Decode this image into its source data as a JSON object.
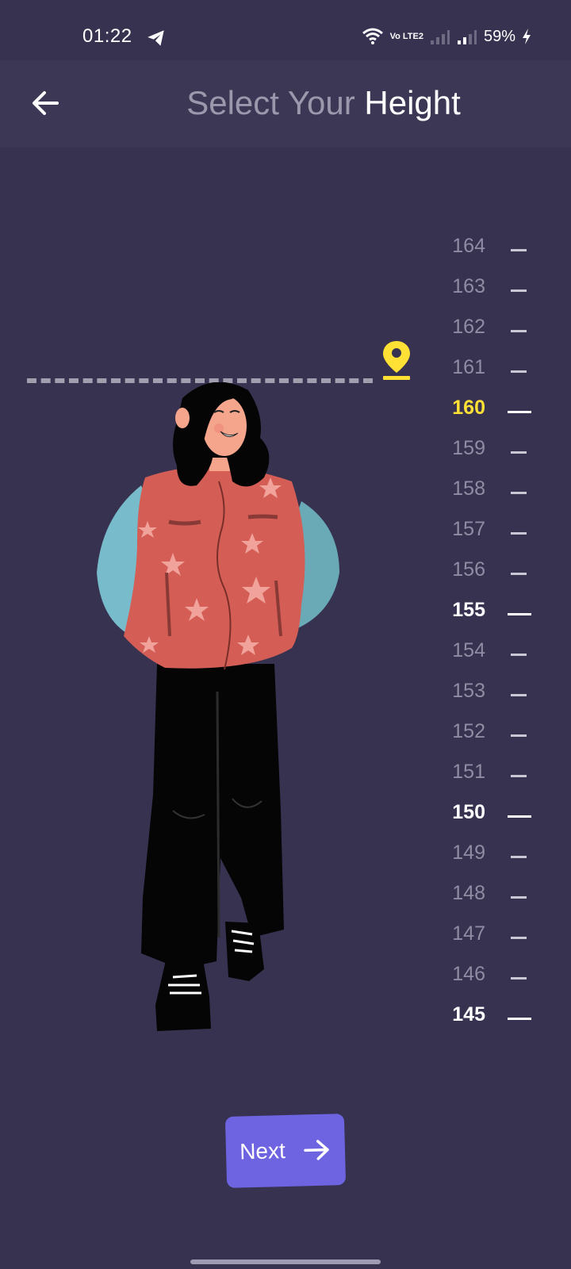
{
  "status_bar": {
    "time": "01:22",
    "battery": "59%",
    "network_tag": "Vo LTE2"
  },
  "header": {
    "title_part1": "Select Your ",
    "title_part2": "Height"
  },
  "ruler": {
    "selected_value": 160,
    "ticks": [
      {
        "label": "164",
        "type": "minor"
      },
      {
        "label": "163",
        "type": "minor"
      },
      {
        "label": "162",
        "type": "minor"
      },
      {
        "label": "161",
        "type": "minor"
      },
      {
        "label": "160",
        "type": "selected"
      },
      {
        "label": "159",
        "type": "minor"
      },
      {
        "label": "158",
        "type": "minor"
      },
      {
        "label": "157",
        "type": "minor"
      },
      {
        "label": "156",
        "type": "minor"
      },
      {
        "label": "155",
        "type": "major"
      },
      {
        "label": "154",
        "type": "minor"
      },
      {
        "label": "153",
        "type": "minor"
      },
      {
        "label": "152",
        "type": "minor"
      },
      {
        "label": "151",
        "type": "minor"
      },
      {
        "label": "150",
        "type": "major"
      },
      {
        "label": "149",
        "type": "minor"
      },
      {
        "label": "148",
        "type": "minor"
      },
      {
        "label": "147",
        "type": "minor"
      },
      {
        "label": "146",
        "type": "minor"
      },
      {
        "label": "145",
        "type": "major"
      }
    ]
  },
  "footer": {
    "next_label": "Next"
  },
  "colors": {
    "background": "#363250",
    "accent_yellow": "#ffe135",
    "button": "#6e63e0"
  }
}
